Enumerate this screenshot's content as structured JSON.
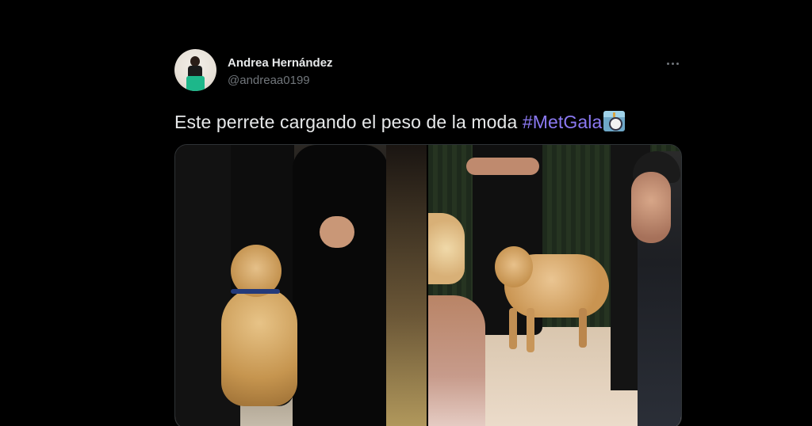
{
  "tweet": {
    "author": {
      "name": "Andrea Hernández",
      "handle": "@andreaa0199"
    },
    "text": "Este perrete cargando el peso de la moda ",
    "hashtag": "#MetGala",
    "emoji_icon": "camera-with-flash-emoji",
    "more_icon": "more-horizontal-icon",
    "media": [
      {
        "description_icon": "photo"
      },
      {
        "description_icon": "photo"
      }
    ]
  },
  "colors": {
    "background": "#000000",
    "text": "#e7e9ea",
    "secondary": "#71767b",
    "hashtag": "#8b79f2",
    "border": "#2f3336"
  }
}
